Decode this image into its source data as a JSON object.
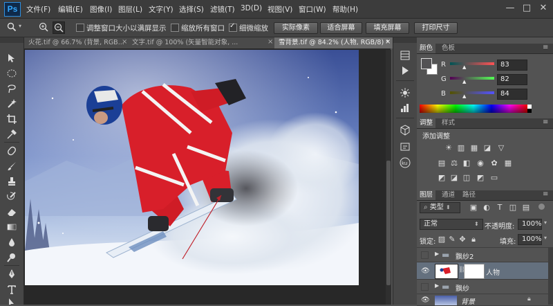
{
  "app": {
    "logo": "Ps"
  },
  "menu": [
    "文件(F)",
    "编辑(E)",
    "图像(I)",
    "图层(L)",
    "文字(Y)",
    "选择(S)",
    "滤镜(T)",
    "3D(D)",
    "视图(V)",
    "窗口(W)",
    "帮助(H)"
  ],
  "window_controls": {
    "minimize": "—",
    "maximize": "□",
    "close": "✕"
  },
  "options": {
    "resize_windows_label": "调整窗口大小以满屏显示",
    "zoom_all_label": "缩放所有窗口",
    "scrubby_zoom_label": "细微缩放",
    "resize_windows_checked": false,
    "zoom_all_checked": false,
    "scrubby_zoom_checked": true,
    "actual_pixels": "实际像素",
    "fit_screen": "适合屏幕",
    "fill_screen": "填充屏幕",
    "print_size": "打印尺寸"
  },
  "tabs": [
    {
      "title": "火花.tif @ 66.7% (背景, RGB...",
      "close": "×",
      "active": false
    },
    {
      "title": "文字.tif @ 100% (矢量智能对象, ...",
      "close": "×",
      "active": false
    },
    {
      "title": "雪背景.tif @ 84.2% (人物, RGB/8) *",
      "close": "×",
      "active": true
    }
  ],
  "color_panel": {
    "tabs": [
      "颜色",
      "色板"
    ],
    "r_label": "R",
    "g_label": "G",
    "b_label": "B",
    "r": "83",
    "g": "82",
    "b": "84",
    "fg_color": "#535254",
    "bg_color": "#ffffff"
  },
  "adjustments_panel": {
    "tabs": [
      "调整",
      "样式"
    ],
    "add_label": "添加调整"
  },
  "layers_panel": {
    "tabs": [
      "图层",
      "通道",
      "路径"
    ],
    "filter_kind": "类型",
    "blend_mode": "正常",
    "opacity_label": "不透明度:",
    "opacity": "100%",
    "lock_label": "锁定:",
    "fill_label": "填充:",
    "fill": "100%",
    "layers": [
      {
        "name": "飘纱2",
        "type": "group",
        "visible": false,
        "selected": false
      },
      {
        "name": "人物",
        "type": "pixel",
        "visible": true,
        "selected": true
      },
      {
        "name": "飘纱",
        "type": "group",
        "visible": false,
        "selected": false
      },
      {
        "name": "背景",
        "type": "background",
        "visible": true,
        "selected": false
      }
    ]
  },
  "colors": {
    "accent_ps": "#31a8ff",
    "selected_layer": "#64707e",
    "jacket_red": "#d81f2a",
    "arrow_red": "#c0202a"
  },
  "icons": {
    "tools": [
      "move-icon",
      "marquee-icon",
      "lasso-icon",
      "quick-select-icon",
      "crop-icon",
      "eyedropper-icon",
      "healing-brush-icon",
      "brush-icon",
      "clone-stamp-icon",
      "history-brush-icon",
      "eraser-icon",
      "gradient-icon",
      "blur-icon",
      "dodge-icon",
      "pen-icon",
      "type-icon",
      "path-select-icon"
    ],
    "mini_panel": [
      "history-icon",
      "play-icon",
      "brush-preset-icon",
      "adjust-icon",
      "info-icon",
      "3d-icon",
      "kuler-icon"
    ]
  }
}
